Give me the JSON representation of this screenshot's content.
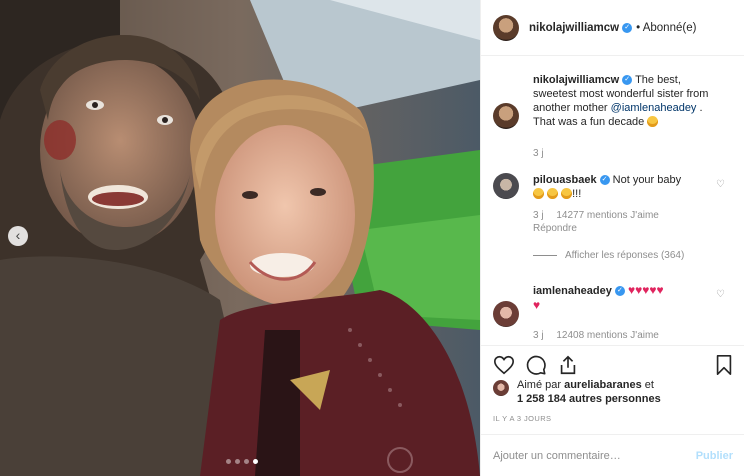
{
  "post": {
    "username": "nikolajwilliamcw",
    "follow_state": "• Abonné(e)",
    "photo_description_icon": "selfie-photo"
  },
  "caption": {
    "username": "nikolajwilliamcw",
    "text_before": "The best, sweetest most wonderful sister from another mother ",
    "mention": "@iamlenaheadey",
    "text_after": " . That was a fun decade",
    "age": "3 j"
  },
  "comments": [
    {
      "username": "pilouasbaek",
      "text": "Not your baby",
      "suffix": "!!!",
      "age": "3 j",
      "likes": "14277 mentions J'aime",
      "reply": "Répondre",
      "view_replies": "Afficher les réponses (364)"
    },
    {
      "username": "iamlenaheadey",
      "age": "3 j",
      "likes": "12408 mentions J'aime"
    }
  ],
  "likes_line": {
    "prefix": "Aimé par ",
    "user": "aureliabaranes",
    "middle": " et",
    "count": "1 258 184 autres personnes"
  },
  "date": "IL Y A 3 JOURS",
  "add_comment": {
    "placeholder": "Ajouter un commentaire…",
    "publish": "Publier"
  },
  "carousel": {
    "count": 4,
    "active_index": 3
  },
  "colors": {
    "accent": "#3897f0",
    "publish_disabled": "#b2dffc",
    "muted": "#8e8e8e"
  }
}
